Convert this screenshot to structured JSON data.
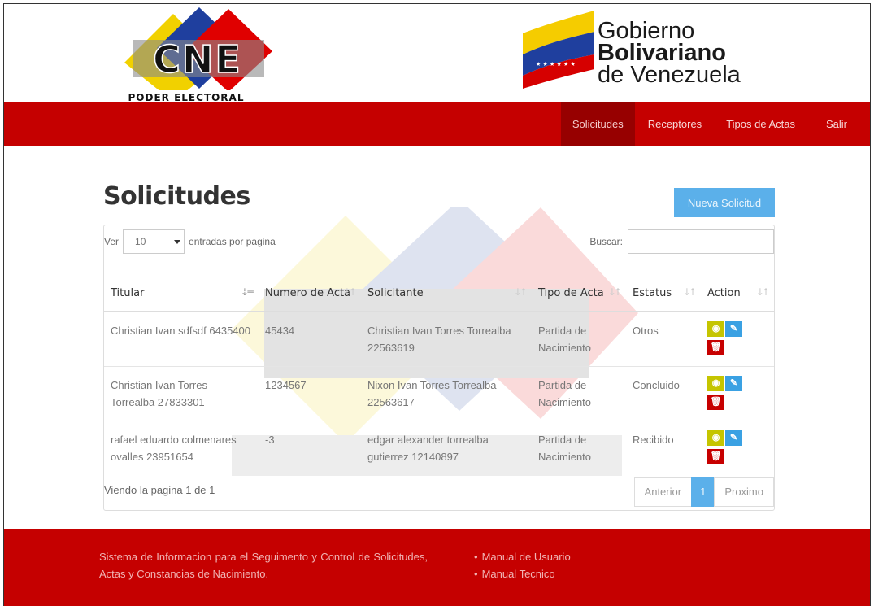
{
  "header": {
    "cne_logo_text": "CNE",
    "cne_logo_sub": "PODER ELECTORAL",
    "gob_line1": "Gobierno",
    "gob_line2": "Bolivariano",
    "gob_line3": "de Venezuela"
  },
  "nav": {
    "items": [
      {
        "label": "Solicitudes",
        "active": true
      },
      {
        "label": "Receptores",
        "active": false
      },
      {
        "label": "Tipos de Actas",
        "active": false
      },
      {
        "label": "Salir",
        "active": false
      }
    ]
  },
  "page": {
    "title": "Solicitudes",
    "new_button": "Nueva Solicitud"
  },
  "table_controls": {
    "ver_label": "Ver",
    "page_size": "10",
    "entries_label": "entradas por pagina",
    "search_label": "Buscar:",
    "search_value": ""
  },
  "table": {
    "columns": [
      {
        "label": "Titular",
        "sort": "asc"
      },
      {
        "label": "Numero de Acta",
        "sort": "none"
      },
      {
        "label": "Solicitante",
        "sort": "none"
      },
      {
        "label": "Tipo de Acta",
        "sort": "none"
      },
      {
        "label": "Estatus",
        "sort": "none"
      },
      {
        "label": "Action",
        "sort": "none"
      }
    ],
    "rows": [
      {
        "titular": "Christian Ivan sdfsdf 6435400",
        "acta": "45434",
        "solicitante": "Christian Ivan Torres Torrealba 22563619",
        "tipo": "Partida de Nacimiento",
        "estatus": "Otros"
      },
      {
        "titular": "Christian Ivan Torres Torrealba 27833301",
        "acta": "1234567",
        "solicitante": "Nixon Ivan Torres Torrealba 22563617",
        "tipo": "Partida de Nacimiento",
        "estatus": "Concluido"
      },
      {
        "titular": "rafael eduardo colmenares ovalles 23951654",
        "acta": "-3",
        "solicitante": "edgar alexander torrealba gutierrez 12140897",
        "tipo": "Partida de Nacimiento",
        "estatus": "Recibido"
      }
    ],
    "info": "Viendo la pagina 1 de 1",
    "pager": {
      "prev": "Anterior",
      "current": "1",
      "next": "Proximo"
    }
  },
  "footer": {
    "description": "Sistema de Informacion para el Seguimento y Control de Solicitudes, Actas y Constancias de Nacimiento.",
    "links": [
      "Manual de Usuario",
      "Manual Tecnico"
    ]
  },
  "colors": {
    "brand_red": "#c50000",
    "nav_active": "#970000",
    "accent_blue": "#5bb0ea",
    "view_yellow": "#c5c500",
    "delete_red": "#c70000"
  }
}
